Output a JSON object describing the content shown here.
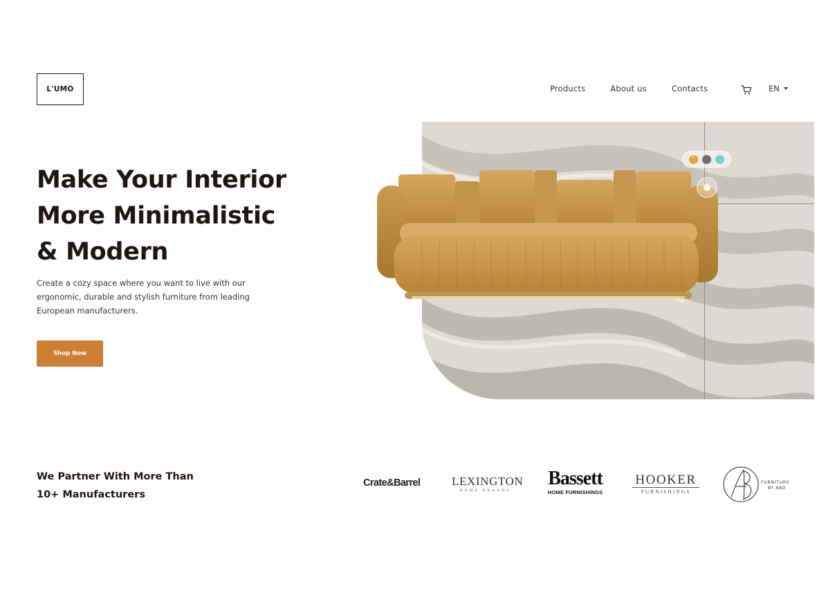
{
  "header": {
    "logo_text": "L'UMO",
    "nav": [
      {
        "label": "Products"
      },
      {
        "label": "About us"
      },
      {
        "label": "Contacts"
      }
    ],
    "cart_icon": "cart-icon",
    "language": "EN"
  },
  "hero": {
    "title_lines": [
      "Make Your Interior",
      "More Minimalistic",
      "& Modern"
    ],
    "description": "Create a cozy space where you want to live with our ergonomic, durable and stylish furniture from leading European manufacturers.",
    "cta_label": "Shop Now",
    "image": "sofa-on-wavy-wall",
    "color_swatches": [
      {
        "color": "#e0a53d",
        "selected": true
      },
      {
        "color": "#6e6e6e",
        "selected": false
      },
      {
        "color": "#7dcfca",
        "selected": false
      }
    ]
  },
  "partners": {
    "title_lines": [
      "We Partner With More Than",
      "10+ Manufacturers"
    ],
    "brands": [
      {
        "name": "Crate&Barrel"
      },
      {
        "name": "LEXINGTON",
        "sub": "HOME BRANDS"
      },
      {
        "name": "Bassett",
        "sub": "HOME FURNISHINGS"
      },
      {
        "name": "HOOKER",
        "sub": "FURNISHINGS"
      },
      {
        "name": "FURNITURE",
        "sub": "BY ABD"
      }
    ]
  },
  "colors": {
    "accent": "#cd7f35",
    "text": "#1f1512",
    "wall": "#d9d5cd",
    "sofa": "#c99a4e"
  }
}
